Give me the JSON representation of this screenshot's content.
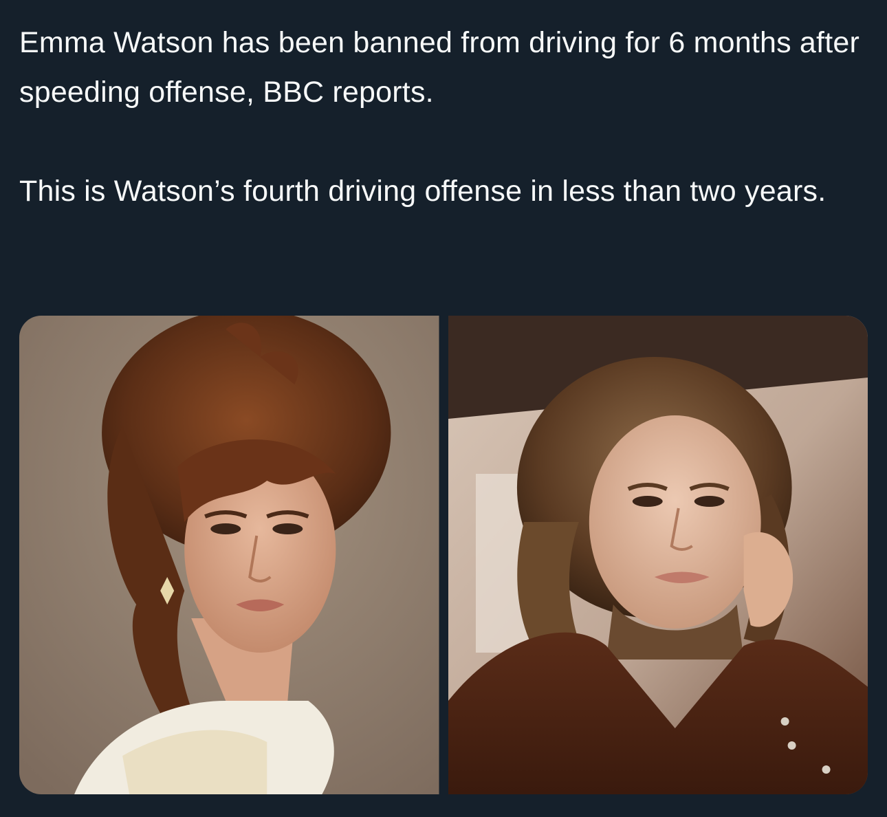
{
  "tweet": {
    "paragraphs": [
      "Emma Watson has been banned from driving for 6 months after speeding offense, BBC reports.",
      "This is Watson’s fourth driving offense in less than two years."
    ]
  },
  "media": [
    {
      "kind": "photo",
      "subject": "portrait-left"
    },
    {
      "kind": "photo",
      "subject": "portrait-right"
    }
  ]
}
